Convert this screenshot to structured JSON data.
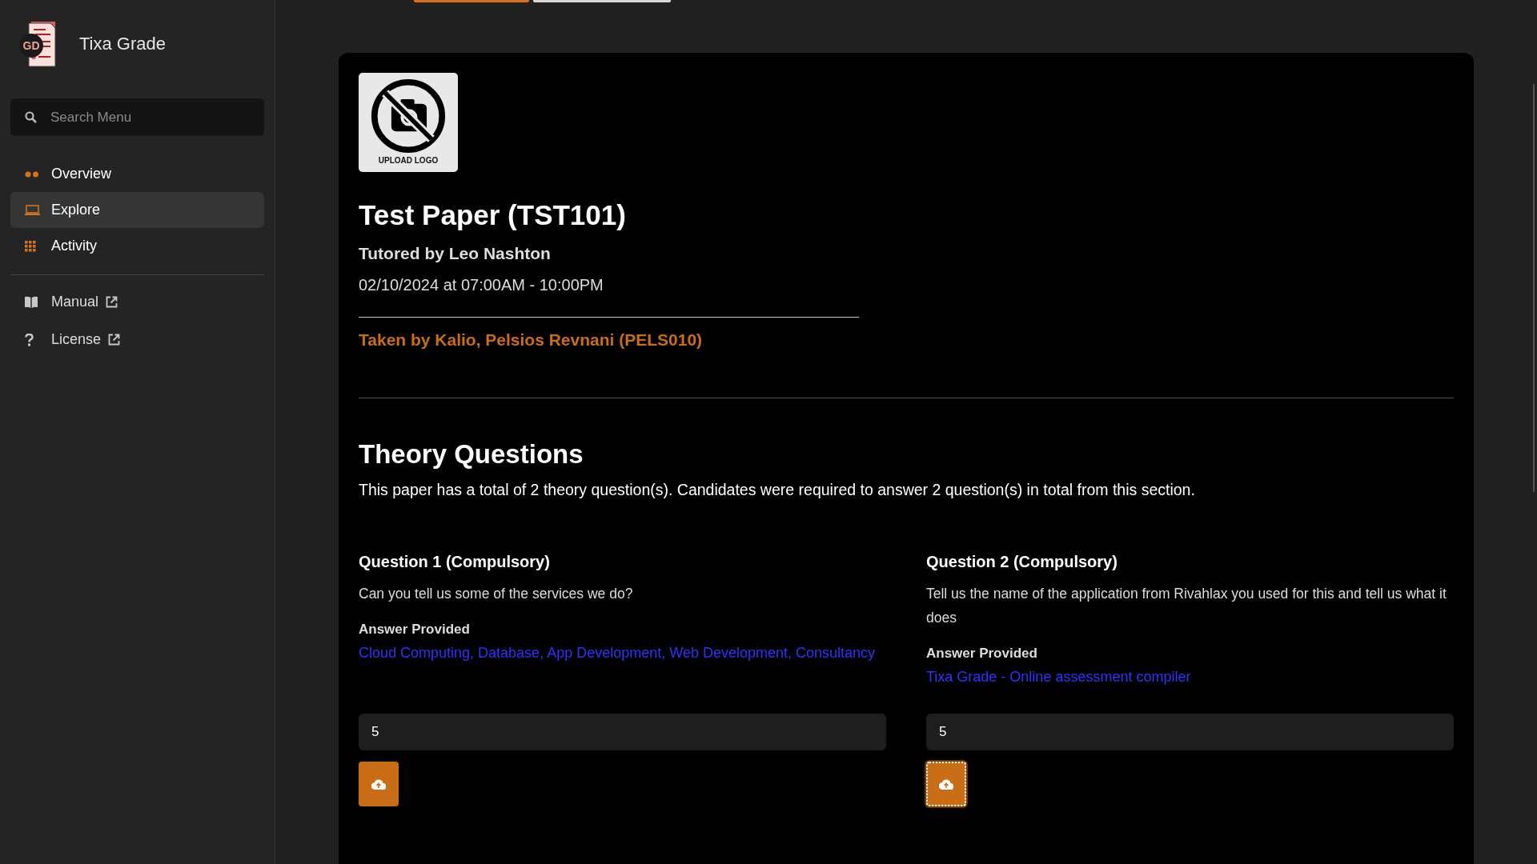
{
  "app": {
    "name": "Tixa Grade",
    "badge": "GD"
  },
  "sidebar": {
    "search": {
      "placeholder": "Search Menu"
    },
    "nav": [
      {
        "label": "Overview",
        "selected": false
      },
      {
        "label": "Explore",
        "selected": true
      },
      {
        "label": "Activity",
        "selected": false
      }
    ],
    "links": [
      {
        "label": "Manual"
      },
      {
        "label": "License"
      }
    ]
  },
  "paper": {
    "logo_caption": "UPLOAD LOGO",
    "title": "Test Paper (TST101)",
    "tutor": "Tutored by Leo Nashton",
    "schedule": "02/10/2024 at 07:00AM - 10:00PM",
    "candidate": "Taken by Kalio, Pelsios Revnani (PELS010)"
  },
  "section": {
    "title": "Theory Questions",
    "description": "This paper has a total of 2 theory question(s). Candidates were required to answer 2 question(s) in total from this section."
  },
  "questions": [
    {
      "title": "Question 1 (Compulsory)",
      "text": "Can you tell us some of the services we do?",
      "answer_label": "Answer Provided",
      "answer": "Cloud Computing, Database, App Development, Web Development, Consultancy",
      "score": "5",
      "focused": false
    },
    {
      "title": "Question 2 (Compulsory)",
      "text": "Tell us the name of the application from Rivahlax you used for this and tell us what it does",
      "answer_label": "Answer Provided",
      "answer": "Tixa Grade - Online assessment compiler",
      "score": "5",
      "focused": true
    }
  ]
}
